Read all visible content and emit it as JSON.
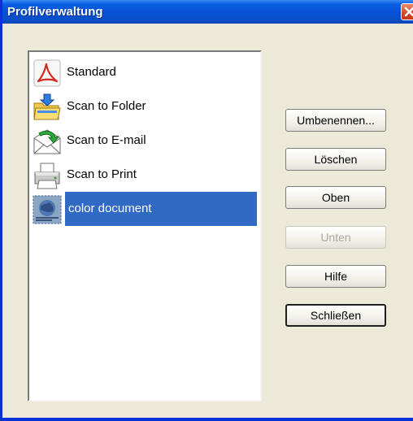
{
  "window": {
    "title": "Profilverwaltung"
  },
  "profiles": [
    {
      "label": "Standard",
      "icon": "pdf-icon"
    },
    {
      "label": "Scan to Folder",
      "icon": "folder-scan-icon"
    },
    {
      "label": "Scan to E-mail",
      "icon": "email-scan-icon"
    },
    {
      "label": "Scan to Print",
      "icon": "printer-icon"
    },
    {
      "label": "color document",
      "icon": "color-document-icon",
      "selected": true
    }
  ],
  "buttons": {
    "rename": "Umbenennen...",
    "delete": "Löschen",
    "up": "Oben",
    "down": "Unten",
    "help": "Hilfe",
    "close": "Schließen"
  },
  "colors": {
    "selection": "#316ac5",
    "titlebar": "#0a5ee0",
    "dialog_bg": "#ece9d8"
  }
}
